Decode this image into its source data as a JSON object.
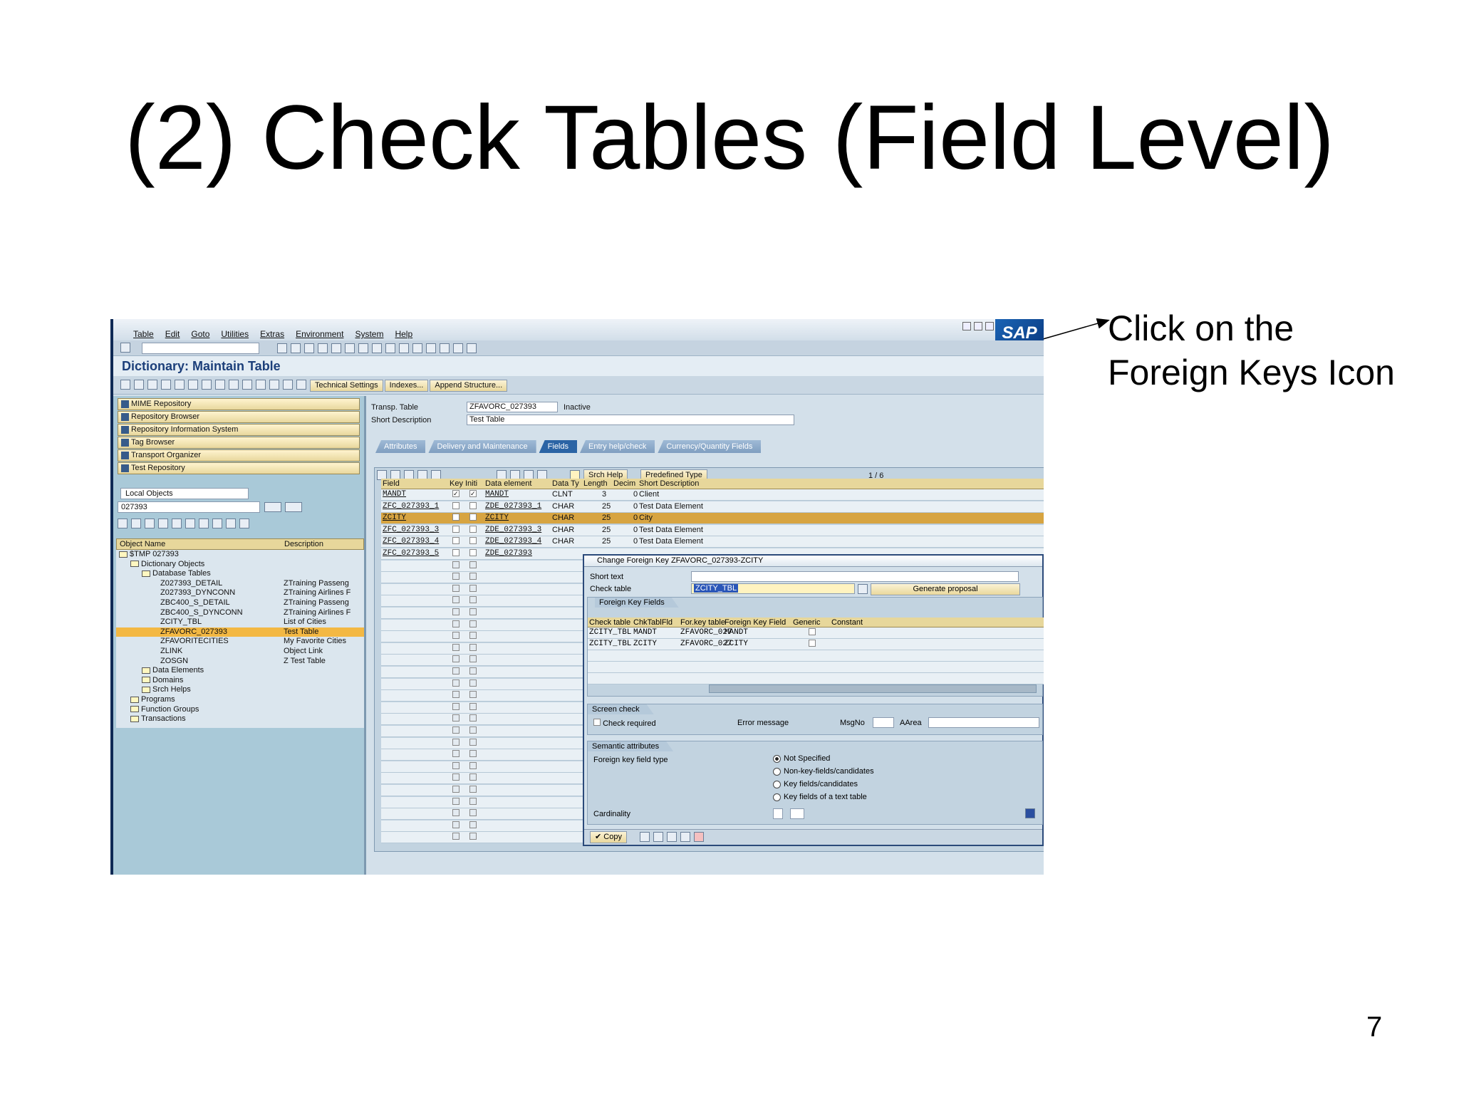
{
  "slide": {
    "title": "(2) Check Tables (Field Level)",
    "callout_line1": "Click on the",
    "callout_line2": "Foreign Keys Icon",
    "page_number": "7"
  },
  "sap": {
    "menu": [
      "Table",
      "Edit",
      "Goto",
      "Utilities",
      "Extras",
      "Environment",
      "System",
      "Help"
    ],
    "logo": "SAP",
    "screen_title": "Dictionary: Maintain Table",
    "app_buttons": {
      "technical_settings": "Technical Settings",
      "indexes": "Indexes...",
      "append_structure": "Append Structure..."
    },
    "nav_buttons": [
      "MIME Repository",
      "Repository Browser",
      "Repository Information System",
      "Tag Browser",
      "Transport Organizer",
      "Test Repository"
    ],
    "object_list_type": "Local Objects",
    "package_value": "027393",
    "tree_columns": {
      "name": "Object Name",
      "description": "Description"
    },
    "tree": [
      {
        "n": "$TMP 027393",
        "d": "",
        "indent": 4,
        "folder": true
      },
      {
        "n": "Dictionary Objects",
        "d": "",
        "indent": 20,
        "folder": true
      },
      {
        "n": "Database Tables",
        "d": "",
        "indent": 36,
        "folder": true
      },
      {
        "n": "Z027393_DETAIL",
        "d": "ZTraining Passeng",
        "indent": 62
      },
      {
        "n": "Z027393_DYNCONN",
        "d": "ZTraining Airlines F",
        "indent": 62
      },
      {
        "n": "ZBC400_S_DETAIL",
        "d": "ZTraining Passeng",
        "indent": 62
      },
      {
        "n": "ZBC400_S_DYNCONN",
        "d": "ZTraining Airlines F",
        "indent": 62
      },
      {
        "n": "ZCITY_TBL",
        "d": "List of Cities",
        "indent": 62
      },
      {
        "n": "ZFAVORC_027393",
        "d": "Test Table",
        "indent": 62,
        "selected": true
      },
      {
        "n": "ZFAVORITECITIES",
        "d": "My Favorite Cities",
        "indent": 62
      },
      {
        "n": "ZLINK",
        "d": "Object Link",
        "indent": 62
      },
      {
        "n": "ZOSGN",
        "d": "Z Test Table",
        "indent": 62
      },
      {
        "n": "Data Elements",
        "d": "",
        "indent": 36,
        "folder": true
      },
      {
        "n": "Domains",
        "d": "",
        "indent": 36,
        "folder": true
      },
      {
        "n": "Srch Helps",
        "d": "",
        "indent": 36,
        "folder": true
      },
      {
        "n": "Programs",
        "d": "",
        "indent": 20,
        "folder": true
      },
      {
        "n": "Function Groups",
        "d": "",
        "indent": 20,
        "folder": true
      },
      {
        "n": "Transactions",
        "d": "",
        "indent": 20,
        "folder": true
      }
    ],
    "transp_table_label": "Transp. Table",
    "transp_table_value": "ZFAVORC_027393",
    "status": "Inactive",
    "short_desc_label": "Short Description",
    "short_desc_value": "Test Table",
    "tabs": [
      "Attributes",
      "Delivery and Maintenance",
      "Fields",
      "Entry help/check",
      "Currency/Quantity Fields"
    ],
    "srch_help": "Srch Help",
    "predefined_type": "Predefined Type",
    "paging": "1  /  6",
    "field_columns": [
      "Field",
      "Key",
      "Initi",
      "Data element",
      "Data Ty",
      "Length",
      "Decim",
      "Short Description"
    ],
    "fields": [
      {
        "field": "MANDT",
        "key": true,
        "init": true,
        "element": "MANDT",
        "type": "CLNT",
        "len": "3",
        "dec": "0",
        "desc": "Client"
      },
      {
        "field": "ZFC_027393_1",
        "key": false,
        "init": false,
        "element": "ZDE_027393_1",
        "type": "CHAR",
        "len": "25",
        "dec": "0",
        "desc": "Test Data Element"
      },
      {
        "field": "ZCITY",
        "key": false,
        "init": false,
        "element": "ZCITY",
        "type": "CHAR",
        "len": "25",
        "dec": "0",
        "desc": "City",
        "selected": true
      },
      {
        "field": "ZFC_027393_3",
        "key": false,
        "init": false,
        "element": "ZDE_027393_3",
        "type": "CHAR",
        "len": "25",
        "dec": "0",
        "desc": "Test Data Element"
      },
      {
        "field": "ZFC_027393_4",
        "key": false,
        "init": false,
        "element": "ZDE_027393_4",
        "type": "CHAR",
        "len": "25",
        "dec": "0",
        "desc": "Test Data Element"
      },
      {
        "field": "ZFC_027393_5",
        "key": false,
        "init": false,
        "element": "ZDE_027393",
        "type": "",
        "len": "",
        "dec": "",
        "desc": ""
      }
    ],
    "popup": {
      "title": "Change Foreign Key ZFAVORC_027393-ZCITY",
      "short_text_label": "Short text",
      "check_table_label": "Check table",
      "check_table_value": "ZCITY_TBL",
      "generate_proposal": "Generate proposal",
      "fk_fields_title": "Foreign Key Fields",
      "fk_columns": [
        "Check table",
        "ChkTablFld",
        "For.key table",
        "Foreign Key Field",
        "Generic",
        "Constant"
      ],
      "fk_rows": [
        {
          "ct": "ZCITY_TBL",
          "cf": "MANDT",
          "ft": "ZFAVORC_027",
          "ff": "MANDT"
        },
        {
          "ct": "ZCITY_TBL",
          "cf": "ZCITY",
          "ft": "ZFAVORC_027",
          "ff": "ZCITY"
        }
      ],
      "screen_check_title": "Screen check",
      "check_required": "Check required",
      "error_message": "Error message",
      "msgno": "MsgNo",
      "aarea": "AArea",
      "semantic_title": "Semantic attributes",
      "fk_field_type": "Foreign key field type",
      "radio_options": [
        "Not Specified",
        "Non-key-fields/candidates",
        "Key fields/candidates",
        "Key fields of a text table"
      ],
      "cardinality": "Cardinality",
      "copy": "Copy"
    }
  }
}
